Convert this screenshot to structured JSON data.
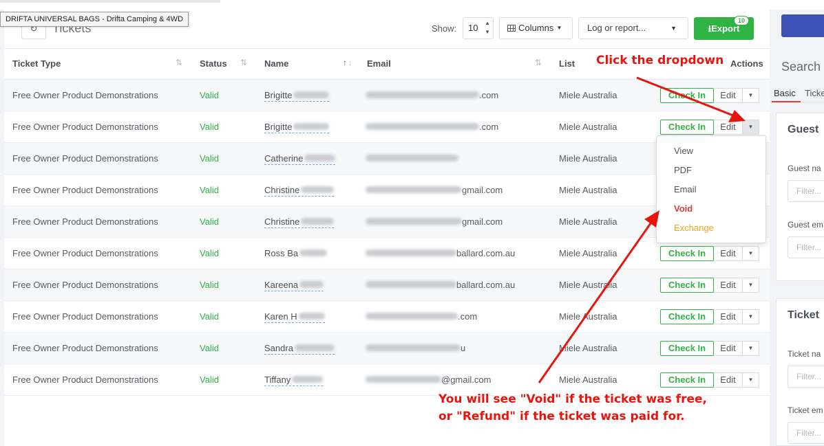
{
  "tooltip": "DRIFTA UNIVERSAL BAGS - Drifta Camping & 4WD",
  "header": {
    "title": "Tickets",
    "show_label": "Show:",
    "show_value": "10",
    "columns_label": "Columns",
    "log_placeholder": "Log or report...",
    "export_label": "Export",
    "export_count": "10"
  },
  "table": {
    "columns": [
      "Ticket Type",
      "Status",
      "Name",
      "Email",
      "List",
      "Actions"
    ],
    "rows": [
      {
        "type": "Free Owner Product Demonstrations",
        "status": "Valid",
        "name": "Brigitte",
        "email_suffix": ".com",
        "list": "Miele Australia"
      },
      {
        "type": "Free Owner Product Demonstrations",
        "status": "Valid",
        "name": "Brigitte",
        "email_suffix": ".com",
        "list": "Miele Australia"
      },
      {
        "type": "Free Owner Product Demonstrations",
        "status": "Valid",
        "name": "Catherine",
        "email_suffix": "",
        "list": "Miele Australia"
      },
      {
        "type": "Free Owner Product Demonstrations",
        "status": "Valid",
        "name": "Christine",
        "email_suffix": "gmail.com",
        "list": "Miele Australia"
      },
      {
        "type": "Free Owner Product Demonstrations",
        "status": "Valid",
        "name": "Christine",
        "email_suffix": "gmail.com",
        "list": "Miele Australia"
      },
      {
        "type": "Free Owner Product Demonstrations",
        "status": "Valid",
        "name": "Ross Ba",
        "email_suffix": "ballard.com.au",
        "list": "Miele Australia"
      },
      {
        "type": "Free Owner Product Demonstrations",
        "status": "Valid",
        "name": "Kareena",
        "email_suffix": "ballard.com.au",
        "list": "Miele Australia"
      },
      {
        "type": "Free Owner Product Demonstrations",
        "status": "Valid",
        "name": "Karen H",
        "email_suffix": ".com",
        "list": "Miele Australia"
      },
      {
        "type": "Free Owner Product Demonstrations",
        "status": "Valid",
        "name": "Sandra",
        "email_suffix": "u",
        "list": "Miele Australia"
      },
      {
        "type": "Free Owner Product Demonstrations",
        "status": "Valid",
        "name": "Tiffany",
        "email_suffix": "@gmail.com",
        "list": "Miele Australia"
      }
    ],
    "actions": {
      "checkin": "Check In",
      "edit": "Edit"
    }
  },
  "dropdown_menu": {
    "items": [
      "View",
      "PDF",
      "Email",
      "Void",
      "Exchange"
    ]
  },
  "sidebar": {
    "search_title": "Search",
    "tabs": [
      "Basic",
      "Ticke"
    ],
    "guest_title": "Guest",
    "guest_name_label": "Guest na",
    "guest_email_label": "Guest em",
    "ticket_title": "Ticket",
    "ticket_name_label": "Ticket na",
    "ticket_email_label": "Ticket em",
    "filter_placeholder": "Filter..."
  },
  "annotations": {
    "click_dropdown": "Click the dropdown",
    "void_line1": "You will see \"Void\" if the ticket was free,",
    "void_line2": "or \"Refund\" if the ticket was paid for."
  },
  "colors": {
    "valid": "#2fb344",
    "export": "#2fb344",
    "void": "#e53935",
    "exchange": "#f5a11b",
    "annotation": "#e8150f",
    "primary": "#3e51b5"
  }
}
